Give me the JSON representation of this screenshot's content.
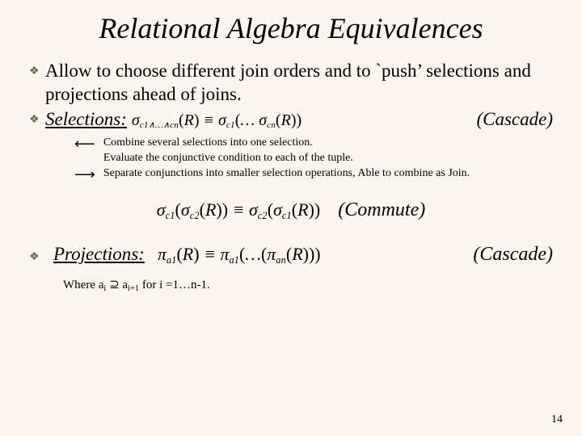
{
  "title": "Relational Algebra Equivalences",
  "bullets": {
    "intro": "Allow to choose different join orders and to `push’ selections and projections ahead of joins.",
    "selections_label": "Selections:",
    "projections_label": "Projections:"
  },
  "formulas": {
    "cascade_sel": "σ_{c1∧…∧cn}(R) ≡ σ_{c1}(… σ_{cn}(R))",
    "commute_sel": "σ_{c1}(σ_{c2}(R)) ≡ σ_{c2}(σ_{c1}(R))",
    "cascade_proj": "π_{a1}(R) ≡ π_{a1}(… (π_{an}(R)))"
  },
  "labels": {
    "cascade": "(Cascade)",
    "commute": "(Commute)"
  },
  "notes": {
    "combine": "Combine several selections into one selection.",
    "evaluate": "Evaluate the conjunctive condition to each of the tuple.",
    "separate": "Separate conjunctions into smaller selection operations, Able to combine as Join."
  },
  "where": {
    "prefix": "Where a",
    "sub_i": "i",
    "superset": " ⊇ a",
    "sub_i1": "i+1",
    "suffix": "   for i =1…n-1."
  },
  "page": "14"
}
